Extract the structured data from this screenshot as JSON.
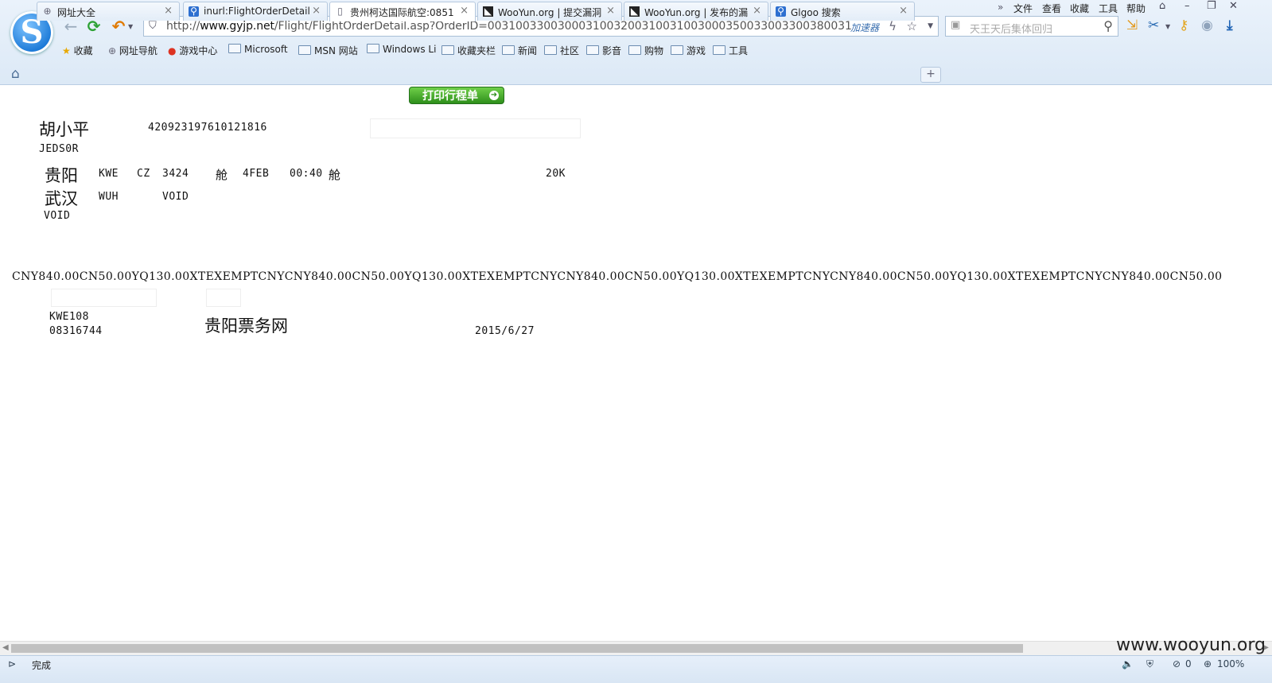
{
  "browser": {
    "logo_letter": "S",
    "back_icon": "←",
    "refresh_icon": "⟳",
    "undo_icon": "↶",
    "url_prefix": "http://",
    "url_domain": "www.gyjp.net",
    "url_path": "/Flight/FlightOrderDetail.asp?OrderID=0031003300300031003200310031003000350033003300380031",
    "accelerator_label": "加速器",
    "search_placeholder": "天王天后集体回归",
    "menu": [
      "文件",
      "查看",
      "收藏",
      "工具",
      "帮助"
    ]
  },
  "bookmarks": [
    {
      "label": "收藏",
      "icon": "star-icon"
    },
    {
      "label": "网址导航",
      "icon": "globe-icon"
    },
    {
      "label": "游戏中心",
      "icon": "game-icon"
    },
    {
      "label": "Microsoft",
      "icon": "folder-icon"
    },
    {
      "label": "MSN 网站",
      "icon": "folder-icon"
    },
    {
      "label": "Windows Li",
      "icon": "folder-icon"
    },
    {
      "label": "收藏夹栏",
      "icon": "folder-icon"
    },
    {
      "label": "新闻",
      "icon": "folder-icon"
    },
    {
      "label": "社区",
      "icon": "folder-icon"
    },
    {
      "label": "影音",
      "icon": "folder-icon"
    },
    {
      "label": "购物",
      "icon": "folder-icon"
    },
    {
      "label": "游戏",
      "icon": "folder-icon"
    },
    {
      "label": "工具",
      "icon": "folder-icon"
    }
  ],
  "tabs": [
    {
      "label": "网址大全",
      "active": false
    },
    {
      "label": "inurl:FlightOrderDetail.",
      "active": false
    },
    {
      "label": "贵州柯达国际航空:0851",
      "active": true
    },
    {
      "label": "WooYun.org | 提交漏洞",
      "active": false
    },
    {
      "label": "WooYun.org | 发布的漏",
      "active": false
    },
    {
      "label": "Glgoo 搜索",
      "active": false
    }
  ],
  "ticket": {
    "print_button": "打印行程单",
    "passenger_name": "胡小平",
    "id_number": "420923197610121816",
    "code_jedsor": "JEDS0R",
    "from_city": "贵阳",
    "from_code": "KWE",
    "airline": "CZ",
    "flight_no": "3424",
    "cabin_label": "舱",
    "date": "4FEB",
    "time": "00:40",
    "cabin_label2": "舱",
    "baggage": "20K",
    "to_city": "武汉",
    "to_code": "WUH",
    "void1": "VOID",
    "void2": "VOID",
    "fare_line": "CNY840.00CN50.00YQ130.00XTEXEMPTCNYCNY840.00CN50.00YQ130.00XTEXEMPTCNYCNY840.00CN50.00YQ130.00XTEXEMPTCNYCNY840.00CN50.00YQ130.00XTEXEMPTCNYCNY840.00CN50.00",
    "agent_code": "KWE108",
    "agent_phone": "08316744",
    "agency_name": "贵阳票务网",
    "issue_date": "2015/6/27"
  },
  "watermark": "www.wooyun.org",
  "status": {
    "text": "完成",
    "count": "0",
    "zoom": "100%"
  }
}
